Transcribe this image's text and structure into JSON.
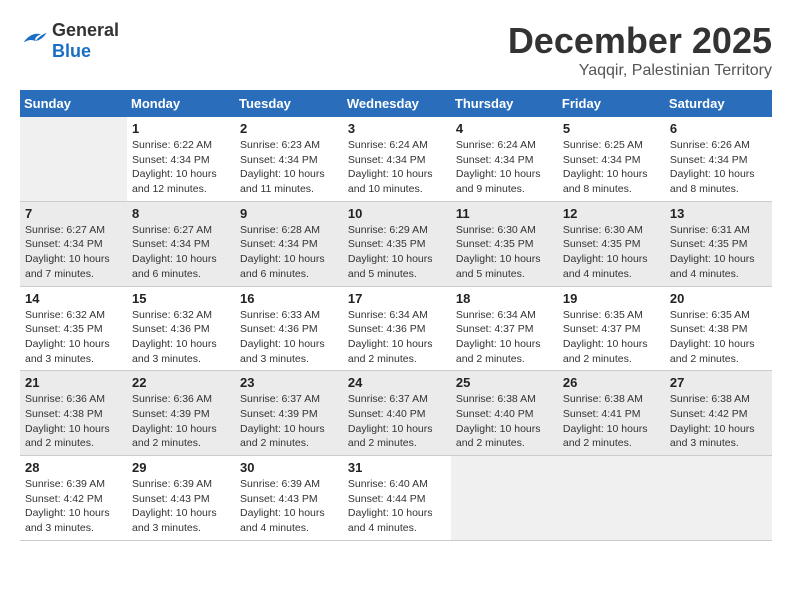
{
  "logo": {
    "general": "General",
    "blue": "Blue"
  },
  "header": {
    "month": "December 2025",
    "location": "Yaqqir, Palestinian Territory"
  },
  "weekdays": [
    "Sunday",
    "Monday",
    "Tuesday",
    "Wednesday",
    "Thursday",
    "Friday",
    "Saturday"
  ],
  "weeks": [
    [
      {
        "day": null,
        "info": null
      },
      {
        "day": "1",
        "sunrise": "6:22 AM",
        "sunset": "4:34 PM",
        "daylight": "10 hours and 12 minutes."
      },
      {
        "day": "2",
        "sunrise": "6:23 AM",
        "sunset": "4:34 PM",
        "daylight": "10 hours and 11 minutes."
      },
      {
        "day": "3",
        "sunrise": "6:24 AM",
        "sunset": "4:34 PM",
        "daylight": "10 hours and 10 minutes."
      },
      {
        "day": "4",
        "sunrise": "6:24 AM",
        "sunset": "4:34 PM",
        "daylight": "10 hours and 9 minutes."
      },
      {
        "day": "5",
        "sunrise": "6:25 AM",
        "sunset": "4:34 PM",
        "daylight": "10 hours and 8 minutes."
      },
      {
        "day": "6",
        "sunrise": "6:26 AM",
        "sunset": "4:34 PM",
        "daylight": "10 hours and 8 minutes."
      }
    ],
    [
      {
        "day": "7",
        "sunrise": "6:27 AM",
        "sunset": "4:34 PM",
        "daylight": "10 hours and 7 minutes."
      },
      {
        "day": "8",
        "sunrise": "6:27 AM",
        "sunset": "4:34 PM",
        "daylight": "10 hours and 6 minutes."
      },
      {
        "day": "9",
        "sunrise": "6:28 AM",
        "sunset": "4:34 PM",
        "daylight": "10 hours and 6 minutes."
      },
      {
        "day": "10",
        "sunrise": "6:29 AM",
        "sunset": "4:35 PM",
        "daylight": "10 hours and 5 minutes."
      },
      {
        "day": "11",
        "sunrise": "6:30 AM",
        "sunset": "4:35 PM",
        "daylight": "10 hours and 5 minutes."
      },
      {
        "day": "12",
        "sunrise": "6:30 AM",
        "sunset": "4:35 PM",
        "daylight": "10 hours and 4 minutes."
      },
      {
        "day": "13",
        "sunrise": "6:31 AM",
        "sunset": "4:35 PM",
        "daylight": "10 hours and 4 minutes."
      }
    ],
    [
      {
        "day": "14",
        "sunrise": "6:32 AM",
        "sunset": "4:35 PM",
        "daylight": "10 hours and 3 minutes."
      },
      {
        "day": "15",
        "sunrise": "6:32 AM",
        "sunset": "4:36 PM",
        "daylight": "10 hours and 3 minutes."
      },
      {
        "day": "16",
        "sunrise": "6:33 AM",
        "sunset": "4:36 PM",
        "daylight": "10 hours and 3 minutes."
      },
      {
        "day": "17",
        "sunrise": "6:34 AM",
        "sunset": "4:36 PM",
        "daylight": "10 hours and 2 minutes."
      },
      {
        "day": "18",
        "sunrise": "6:34 AM",
        "sunset": "4:37 PM",
        "daylight": "10 hours and 2 minutes."
      },
      {
        "day": "19",
        "sunrise": "6:35 AM",
        "sunset": "4:37 PM",
        "daylight": "10 hours and 2 minutes."
      },
      {
        "day": "20",
        "sunrise": "6:35 AM",
        "sunset": "4:38 PM",
        "daylight": "10 hours and 2 minutes."
      }
    ],
    [
      {
        "day": "21",
        "sunrise": "6:36 AM",
        "sunset": "4:38 PM",
        "daylight": "10 hours and 2 minutes."
      },
      {
        "day": "22",
        "sunrise": "6:36 AM",
        "sunset": "4:39 PM",
        "daylight": "10 hours and 2 minutes."
      },
      {
        "day": "23",
        "sunrise": "6:37 AM",
        "sunset": "4:39 PM",
        "daylight": "10 hours and 2 minutes."
      },
      {
        "day": "24",
        "sunrise": "6:37 AM",
        "sunset": "4:40 PM",
        "daylight": "10 hours and 2 minutes."
      },
      {
        "day": "25",
        "sunrise": "6:38 AM",
        "sunset": "4:40 PM",
        "daylight": "10 hours and 2 minutes."
      },
      {
        "day": "26",
        "sunrise": "6:38 AM",
        "sunset": "4:41 PM",
        "daylight": "10 hours and 2 minutes."
      },
      {
        "day": "27",
        "sunrise": "6:38 AM",
        "sunset": "4:42 PM",
        "daylight": "10 hours and 3 minutes."
      }
    ],
    [
      {
        "day": "28",
        "sunrise": "6:39 AM",
        "sunset": "4:42 PM",
        "daylight": "10 hours and 3 minutes."
      },
      {
        "day": "29",
        "sunrise": "6:39 AM",
        "sunset": "4:43 PM",
        "daylight": "10 hours and 3 minutes."
      },
      {
        "day": "30",
        "sunrise": "6:39 AM",
        "sunset": "4:43 PM",
        "daylight": "10 hours and 4 minutes."
      },
      {
        "day": "31",
        "sunrise": "6:40 AM",
        "sunset": "4:44 PM",
        "daylight": "10 hours and 4 minutes."
      },
      {
        "day": null,
        "info": null
      },
      {
        "day": null,
        "info": null
      },
      {
        "day": null,
        "info": null
      }
    ]
  ]
}
